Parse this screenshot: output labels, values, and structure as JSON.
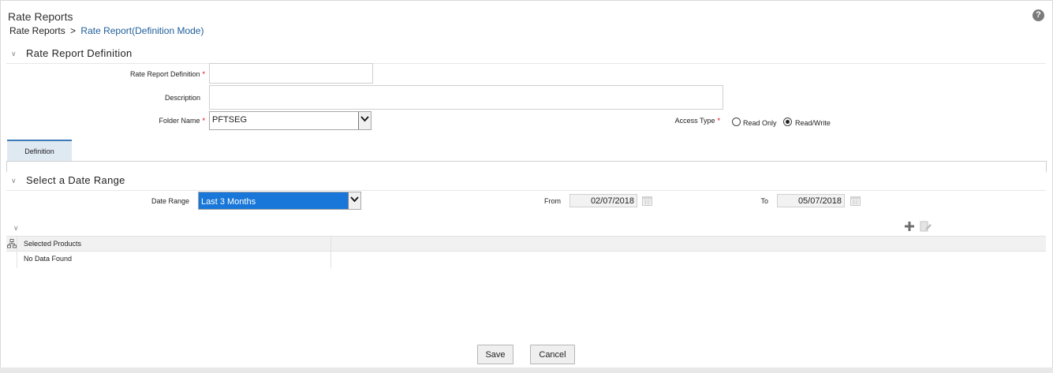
{
  "header": {
    "title": "Rate Reports",
    "breadcrumb": {
      "root": "Rate Reports",
      "separator": ">",
      "current": "Rate Report(Definition Mode)"
    },
    "help_icon": "question-circle-icon"
  },
  "definition_section": {
    "title": "Rate Report Definition",
    "fields": {
      "rate_report_definition": {
        "label": "Rate Report Definition",
        "required": "*",
        "value": ""
      },
      "description": {
        "label": "Description",
        "value": ""
      },
      "folder_name": {
        "label": "Folder Name",
        "required": "*",
        "value": "PFTSEG"
      },
      "access_type": {
        "label": "Access Type",
        "required": "*",
        "options": [
          "Read Only",
          "Read/Write"
        ],
        "selected": "Read/Write"
      }
    }
  },
  "tabs": [
    {
      "label": "Definition",
      "active": true
    }
  ],
  "date_section": {
    "title": "Select a Date Range",
    "date_range_label": "Date Range",
    "date_range_value": "Last 3 Months",
    "from_label": "From",
    "from_value": "02/07/2018",
    "to_label": "To",
    "to_value": "05/07/2018"
  },
  "products_grid": {
    "column_header": "Selected Products",
    "empty_text": "No Data Found",
    "toolbar_icons": [
      "add-icon",
      "edit-icon"
    ]
  },
  "footer": {
    "save_label": "Save",
    "cancel_label": "Cancel"
  },
  "colors": {
    "accent_blue": "#1877d8",
    "link_blue": "#1e5d99",
    "required_red": "#dd0000",
    "tab_bg": "#dfe9f2"
  }
}
